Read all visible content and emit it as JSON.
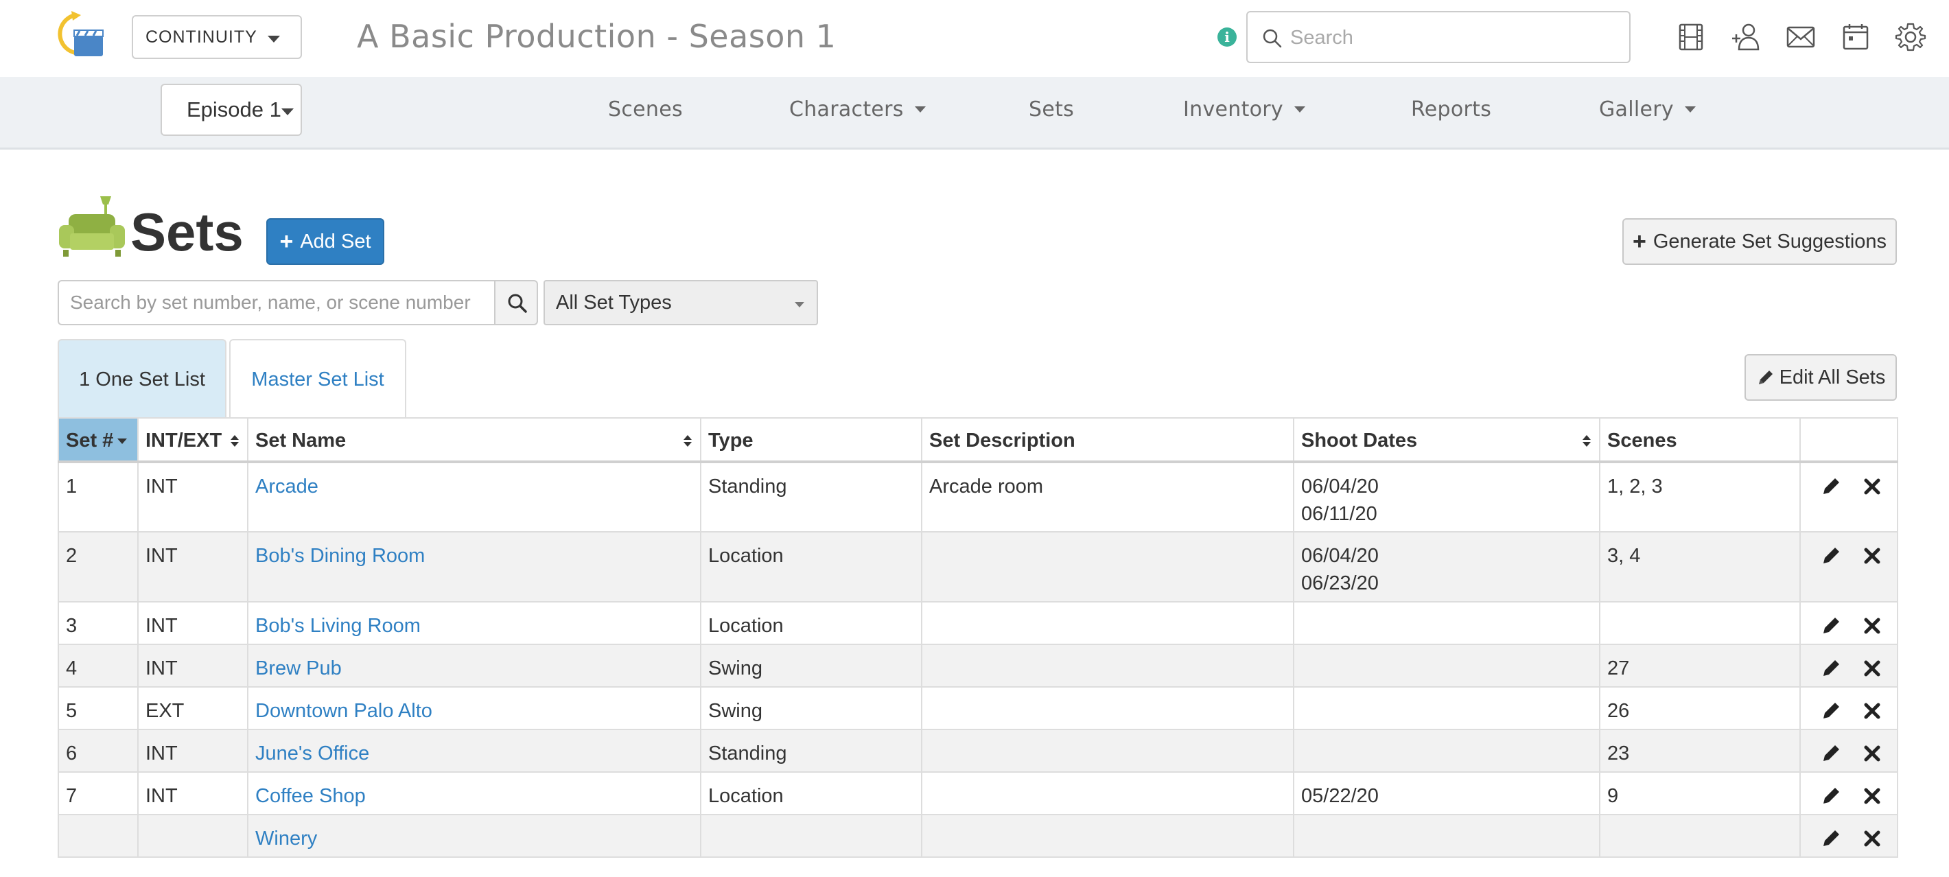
{
  "header": {
    "module": "CONTINUITY",
    "production_title": "A Basic Production - Season 1",
    "info_label": "i",
    "search_placeholder": "Search"
  },
  "nav": {
    "episode": "Episode 1",
    "items": [
      {
        "label": "Scenes",
        "dropdown": false
      },
      {
        "label": "Characters",
        "dropdown": true
      },
      {
        "label": "Sets",
        "dropdown": false
      },
      {
        "label": "Inventory",
        "dropdown": true
      },
      {
        "label": "Reports",
        "dropdown": false
      },
      {
        "label": "Gallery",
        "dropdown": true
      }
    ]
  },
  "page": {
    "title": "Sets",
    "add_button": "Add Set",
    "generate_button": "Generate Set Suggestions",
    "edit_all_button": "Edit All Sets"
  },
  "filters": {
    "search_placeholder": "Search by set number, name, or scene number",
    "set_type": "All Set Types"
  },
  "tabs": {
    "active": "1 One Set List",
    "inactive": "Master Set List"
  },
  "table": {
    "headers": {
      "set_num": "Set #",
      "int_ext": "INT/EXT",
      "set_name": "Set Name",
      "type": "Type",
      "description": "Set Description",
      "shoot_dates": "Shoot Dates",
      "scenes": "Scenes"
    },
    "rows": [
      {
        "num": "1",
        "int_ext": "INT",
        "name": "Arcade",
        "type": "Standing",
        "description": "Arcade room",
        "dates": [
          "06/04/20",
          "06/11/20"
        ],
        "scenes": "1, 2, 3"
      },
      {
        "num": "2",
        "int_ext": "INT",
        "name": "Bob's Dining Room",
        "type": "Location",
        "description": "",
        "dates": [
          "06/04/20",
          "06/23/20"
        ],
        "scenes": "3, 4"
      },
      {
        "num": "3",
        "int_ext": "INT",
        "name": "Bob's Living Room",
        "type": "Location",
        "description": "",
        "dates": [],
        "scenes": ""
      },
      {
        "num": "4",
        "int_ext": "INT",
        "name": "Brew Pub",
        "type": "Swing",
        "description": "",
        "dates": [],
        "scenes": "27"
      },
      {
        "num": "5",
        "int_ext": "EXT",
        "name": "Downtown Palo Alto",
        "type": "Swing",
        "description": "",
        "dates": [],
        "scenes": "26"
      },
      {
        "num": "6",
        "int_ext": "INT",
        "name": "June's Office",
        "type": "Standing",
        "description": "",
        "dates": [],
        "scenes": "23"
      },
      {
        "num": "7",
        "int_ext": "INT",
        "name": "Coffee Shop",
        "type": "Location",
        "description": "",
        "dates": [
          "05/22/20"
        ],
        "scenes": "9"
      },
      {
        "num": "",
        "int_ext": "",
        "name": "Winery",
        "type": "",
        "description": "",
        "dates": [],
        "scenes": ""
      }
    ]
  },
  "colors": {
    "primary": "#2f80c3",
    "link": "#2f80c3",
    "sorted_header": "#8ebfdf",
    "active_tab": "#d8ebf6",
    "info": "#3ab39a",
    "logo_yellow": "#f2c230",
    "logo_blue": "#4a86c7",
    "couch_green": "#9bbf4a"
  },
  "icons": {
    "logo": "continuity-logo",
    "info": "info-icon",
    "search": "search-icon",
    "film": "film-icon",
    "add_user": "add-user-icon",
    "mail": "mail-icon",
    "calendar": "calendar-icon",
    "settings": "gear-icon",
    "page": "couch-icon",
    "edit": "pencil-icon",
    "delete": "close-icon"
  }
}
